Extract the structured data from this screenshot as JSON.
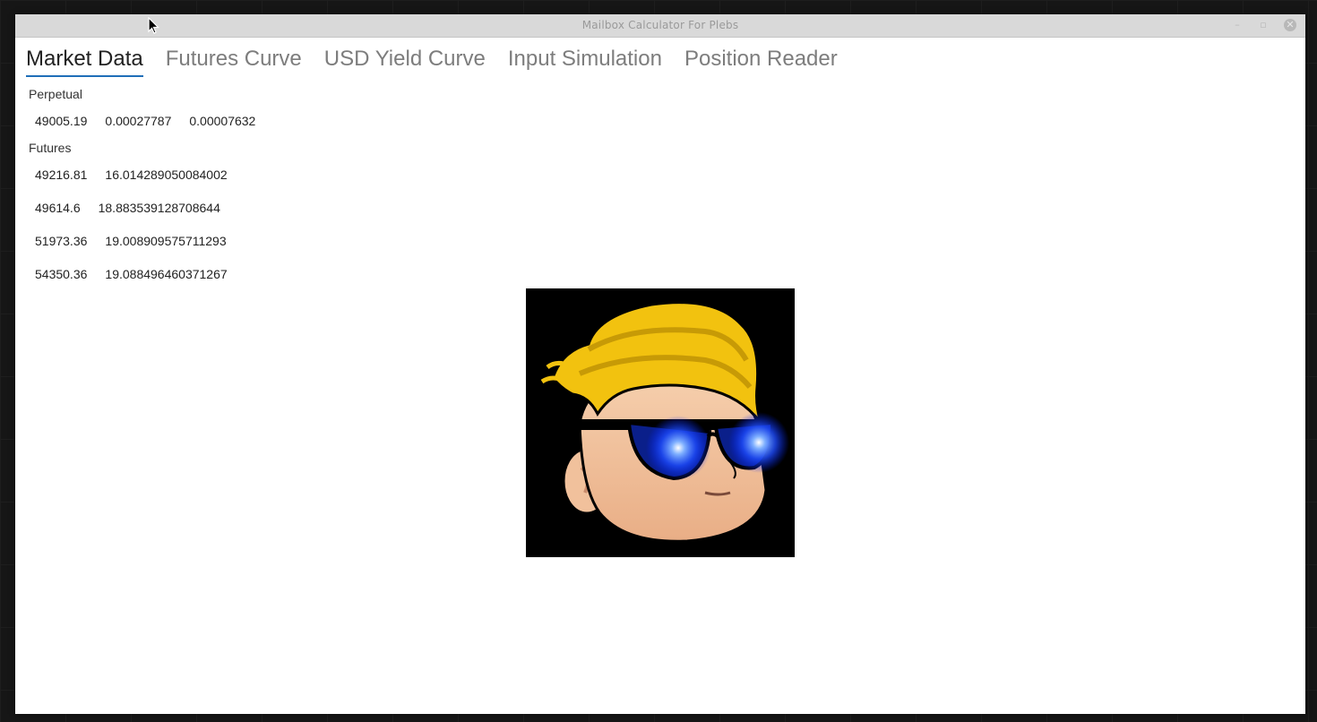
{
  "window": {
    "title": "Mailbox Calculator For Plebs",
    "controls": {
      "minimize": "–",
      "maximize": "▫",
      "close": "✕"
    }
  },
  "tabs": [
    {
      "label": "Market Data",
      "active": true
    },
    {
      "label": "Futures Curve",
      "active": false
    },
    {
      "label": "USD Yield Curve",
      "active": false
    },
    {
      "label": "Input Simulation",
      "active": false
    },
    {
      "label": "Position Reader",
      "active": false
    }
  ],
  "perpetual": {
    "label": "Perpetual",
    "values": [
      "49005.19",
      "0.00027787",
      "0.00007632"
    ]
  },
  "futures": {
    "label": "Futures",
    "rows": [
      [
        "49216.81",
        "16.014289050084002"
      ],
      [
        "49614.6",
        "18.883539128708644"
      ],
      [
        "51973.36",
        "19.008909575711293"
      ],
      [
        "54350.36",
        "19.088496460371267"
      ]
    ]
  },
  "image": {
    "icon": "wallstreetbets-mascot-icon"
  },
  "colors": {
    "accent": "#1f6fb8",
    "titlebar": "#d9d9d9",
    "hair": "#f2c20f",
    "skin": "#f3c49f",
    "glow": "#2f6bff"
  }
}
